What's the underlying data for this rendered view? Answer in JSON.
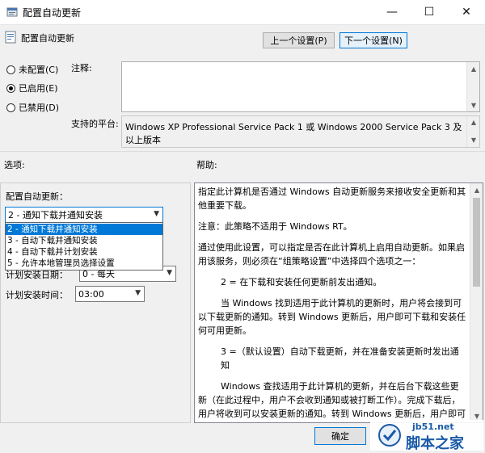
{
  "window": {
    "title": "配置自动更新",
    "minimize_glyph": "—",
    "maximize_glyph": "☐",
    "close_glyph": "✕"
  },
  "header": {
    "setting_name": "配置自动更新",
    "prev_button": "上一个设置(P)",
    "next_button": "下一个设置(N)"
  },
  "state_options": [
    {
      "label": "未配置(C)",
      "checked": false
    },
    {
      "label": "已启用(E)",
      "checked": true
    },
    {
      "label": "已禁用(D)",
      "checked": false
    }
  ],
  "comment": {
    "label": "注释:",
    "value": ""
  },
  "platform": {
    "label": "支持的平台:",
    "value": "Windows XP Professional Service Pack 1 或 Windows 2000 Service Pack 3 及以上版本"
  },
  "options_section": {
    "label": "选项:",
    "configure_label": "配置自动更新：",
    "selected_value": "2 - 通知下载并通知安装",
    "dropdown_items": [
      "2 - 通知下载并通知安装",
      "3 - 自动下载并通知安装",
      "4 - 自动下载并计划安装",
      "5 - 允许本地管理员选择设置"
    ],
    "schedule_day_label": "计划安装日期：",
    "schedule_day_value": "0 - 每天",
    "schedule_time_label": "计划安装时间：",
    "schedule_time_value": "03:00"
  },
  "help_section": {
    "label": "帮助:",
    "paragraphs": [
      "指定此计算机是否通过 Windows 自动更新服务来接收安全更新和其他重要下载。",
      "注意：此策略不适用于 Windows RT。",
      "通过使用此设置，可以指定是否在此计算机上启用自动更新。如果启用该服务，则必须在“组策略设置”中选择四个选项之一：",
      "2 = 在下载和安装任何更新前发出通知。",
      "当 Windows 找到适用于此计算机的更新时，用户将会接到可以下载更新的通知。转到 Windows 更新后，用户即可下载和安装任何可用更新。",
      "3 =（默认设置）自动下载更新，并在准备安装更新时发出通知",
      "Windows 查找适用于此计算机的更新，并在后台下载这些更新（在此过程中，用户不会收到通知或被打断工作）。完成下载后，用户将收到可以安装更新的通知。转到 Windows 更新后，用户即可安装更新。"
    ]
  },
  "footer": {
    "ok_button": "确定"
  },
  "watermark": {
    "site": "jb51.net",
    "brand": "脚本之家"
  }
}
